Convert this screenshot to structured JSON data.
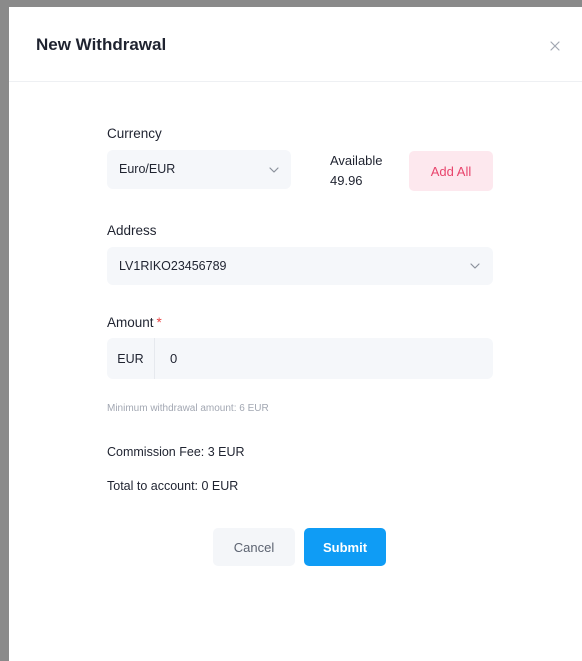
{
  "modal": {
    "title": "New Withdrawal"
  },
  "currency": {
    "label": "Currency",
    "selected": "Euro/EUR"
  },
  "available": {
    "label": "Available",
    "value": "49.96"
  },
  "add_all_label": "Add All",
  "address": {
    "label": "Address",
    "selected": "LV1RIKO23456789"
  },
  "amount": {
    "label": "Amount",
    "required_marker": "*",
    "prefix": "EUR",
    "value": "0",
    "hint": "Minimum withdrawal amount: 6 EUR"
  },
  "commission_fee": "Commission Fee: 3 EUR",
  "total_to_account": "Total to account: 0 EUR",
  "buttons": {
    "cancel": "Cancel",
    "submit": "Submit"
  },
  "colors": {
    "primary": "#0f9cf5",
    "add_all_text": "#e8446c",
    "add_all_bg": "#fde8ee",
    "required": "#e84545",
    "field_bg": "#f5f7fa"
  },
  "icons": {
    "close": "close-icon",
    "dropdown": "chevron-down-icon"
  }
}
